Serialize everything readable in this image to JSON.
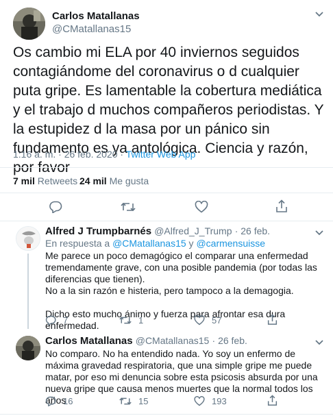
{
  "tweet": {
    "name": "Carlos Matallanas",
    "handle": "@CMatallanas15",
    "text": "Os cambio mi ELA por 40 inviernos seguidos contagiándome del coronavirus o d cualquier puta gripe. Es lamentable la cobertura mediática y el trabajo d muchos compañeros periodistas. Y la estupidez d la masa por un pánico sin fundamento es ya antológica. Ciencia y razón, por favor",
    "time": "1:16 a. m. · 26 feb. 2020 · ",
    "source": "Twitter Web App",
    "retweets_count": "7 mil",
    "retweets_label": " Retweets",
    "likes_count": "24 mil",
    "likes_label": " Me gusta"
  },
  "replies": [
    {
      "name": "Alfred J Trumpbarnés",
      "handle": "@Alfred_J_Trump",
      "date": "· 26 feb.",
      "reply_prefix": "En respuesta a ",
      "reply_user1": "@CMatallanas15",
      "reply_and": " y ",
      "reply_user2": "@carmensuisse",
      "text_p1": "Me parece un poco demagógico el comparar una enfermedad tremendamente grave, con una posible pandemia (por todas las diferencias que tienen).",
      "text_p2": "No a la sin razón e histeria, pero tampoco a la demagogia.",
      "text_p3": "Dicho esto mucho ánimo y fuerza para afrontar esa dura enfermedad.",
      "replies": "7",
      "retweets": "1",
      "likes": "57"
    },
    {
      "name": "Carlos Matallanas",
      "handle": "@CMatallanas15",
      "date": "· 26 feb.",
      "text_p1": "No comparo. No ha entendido nada. Yo soy un enfermo de máxima gravedad respiratoria, que una simple gripe me puede matar, por eso mi denuncia sobre esta psicosis absurda por una nueva gripe que causa menos muertes que la normal todos los años",
      "replies": "16",
      "retweets": "15",
      "likes": "193"
    }
  ],
  "icons": {
    "chevron": "chevron-down-icon",
    "reply": "reply-icon",
    "retweet": "retweet-icon",
    "like": "heart-icon",
    "share": "share-icon"
  },
  "colors": {
    "link": "#1b95e0",
    "muted": "#657786",
    "text": "#14171a",
    "divider": "#e6ecf0",
    "reply_line": "#ccd6dd"
  }
}
